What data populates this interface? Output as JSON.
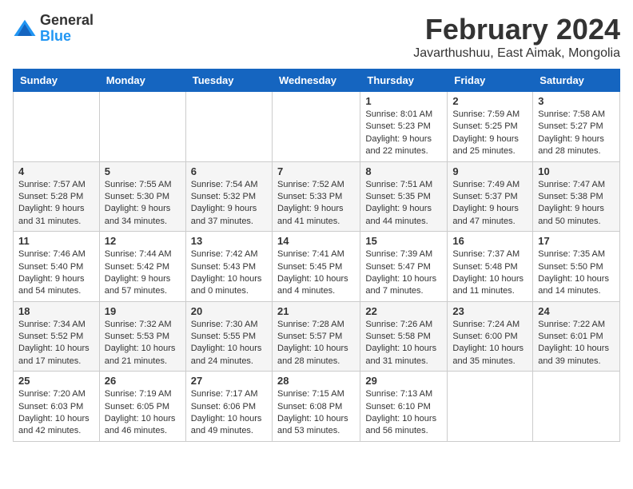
{
  "logo": {
    "general": "General",
    "blue": "Blue"
  },
  "title": "February 2024",
  "location": "Javarthushuu, East Aimak, Mongolia",
  "weekdays": [
    "Sunday",
    "Monday",
    "Tuesday",
    "Wednesday",
    "Thursday",
    "Friday",
    "Saturday"
  ],
  "weeks": [
    [
      {
        "day": "",
        "sunrise": "",
        "sunset": "",
        "daylight": ""
      },
      {
        "day": "",
        "sunrise": "",
        "sunset": "",
        "daylight": ""
      },
      {
        "day": "",
        "sunrise": "",
        "sunset": "",
        "daylight": ""
      },
      {
        "day": "",
        "sunrise": "",
        "sunset": "",
        "daylight": ""
      },
      {
        "day": "1",
        "sunrise": "Sunrise: 8:01 AM",
        "sunset": "Sunset: 5:23 PM",
        "daylight": "Daylight: 9 hours and 22 minutes."
      },
      {
        "day": "2",
        "sunrise": "Sunrise: 7:59 AM",
        "sunset": "Sunset: 5:25 PM",
        "daylight": "Daylight: 9 hours and 25 minutes."
      },
      {
        "day": "3",
        "sunrise": "Sunrise: 7:58 AM",
        "sunset": "Sunset: 5:27 PM",
        "daylight": "Daylight: 9 hours and 28 minutes."
      }
    ],
    [
      {
        "day": "4",
        "sunrise": "Sunrise: 7:57 AM",
        "sunset": "Sunset: 5:28 PM",
        "daylight": "Daylight: 9 hours and 31 minutes."
      },
      {
        "day": "5",
        "sunrise": "Sunrise: 7:55 AM",
        "sunset": "Sunset: 5:30 PM",
        "daylight": "Daylight: 9 hours and 34 minutes."
      },
      {
        "day": "6",
        "sunrise": "Sunrise: 7:54 AM",
        "sunset": "Sunset: 5:32 PM",
        "daylight": "Daylight: 9 hours and 37 minutes."
      },
      {
        "day": "7",
        "sunrise": "Sunrise: 7:52 AM",
        "sunset": "Sunset: 5:33 PM",
        "daylight": "Daylight: 9 hours and 41 minutes."
      },
      {
        "day": "8",
        "sunrise": "Sunrise: 7:51 AM",
        "sunset": "Sunset: 5:35 PM",
        "daylight": "Daylight: 9 hours and 44 minutes."
      },
      {
        "day": "9",
        "sunrise": "Sunrise: 7:49 AM",
        "sunset": "Sunset: 5:37 PM",
        "daylight": "Daylight: 9 hours and 47 minutes."
      },
      {
        "day": "10",
        "sunrise": "Sunrise: 7:47 AM",
        "sunset": "Sunset: 5:38 PM",
        "daylight": "Daylight: 9 hours and 50 minutes."
      }
    ],
    [
      {
        "day": "11",
        "sunrise": "Sunrise: 7:46 AM",
        "sunset": "Sunset: 5:40 PM",
        "daylight": "Daylight: 9 hours and 54 minutes."
      },
      {
        "day": "12",
        "sunrise": "Sunrise: 7:44 AM",
        "sunset": "Sunset: 5:42 PM",
        "daylight": "Daylight: 9 hours and 57 minutes."
      },
      {
        "day": "13",
        "sunrise": "Sunrise: 7:42 AM",
        "sunset": "Sunset: 5:43 PM",
        "daylight": "Daylight: 10 hours and 0 minutes."
      },
      {
        "day": "14",
        "sunrise": "Sunrise: 7:41 AM",
        "sunset": "Sunset: 5:45 PM",
        "daylight": "Daylight: 10 hours and 4 minutes."
      },
      {
        "day": "15",
        "sunrise": "Sunrise: 7:39 AM",
        "sunset": "Sunset: 5:47 PM",
        "daylight": "Daylight: 10 hours and 7 minutes."
      },
      {
        "day": "16",
        "sunrise": "Sunrise: 7:37 AM",
        "sunset": "Sunset: 5:48 PM",
        "daylight": "Daylight: 10 hours and 11 minutes."
      },
      {
        "day": "17",
        "sunrise": "Sunrise: 7:35 AM",
        "sunset": "Sunset: 5:50 PM",
        "daylight": "Daylight: 10 hours and 14 minutes."
      }
    ],
    [
      {
        "day": "18",
        "sunrise": "Sunrise: 7:34 AM",
        "sunset": "Sunset: 5:52 PM",
        "daylight": "Daylight: 10 hours and 17 minutes."
      },
      {
        "day": "19",
        "sunrise": "Sunrise: 7:32 AM",
        "sunset": "Sunset: 5:53 PM",
        "daylight": "Daylight: 10 hours and 21 minutes."
      },
      {
        "day": "20",
        "sunrise": "Sunrise: 7:30 AM",
        "sunset": "Sunset: 5:55 PM",
        "daylight": "Daylight: 10 hours and 24 minutes."
      },
      {
        "day": "21",
        "sunrise": "Sunrise: 7:28 AM",
        "sunset": "Sunset: 5:57 PM",
        "daylight": "Daylight: 10 hours and 28 minutes."
      },
      {
        "day": "22",
        "sunrise": "Sunrise: 7:26 AM",
        "sunset": "Sunset: 5:58 PM",
        "daylight": "Daylight: 10 hours and 31 minutes."
      },
      {
        "day": "23",
        "sunrise": "Sunrise: 7:24 AM",
        "sunset": "Sunset: 6:00 PM",
        "daylight": "Daylight: 10 hours and 35 minutes."
      },
      {
        "day": "24",
        "sunrise": "Sunrise: 7:22 AM",
        "sunset": "Sunset: 6:01 PM",
        "daylight": "Daylight: 10 hours and 39 minutes."
      }
    ],
    [
      {
        "day": "25",
        "sunrise": "Sunrise: 7:20 AM",
        "sunset": "Sunset: 6:03 PM",
        "daylight": "Daylight: 10 hours and 42 minutes."
      },
      {
        "day": "26",
        "sunrise": "Sunrise: 7:19 AM",
        "sunset": "Sunset: 6:05 PM",
        "daylight": "Daylight: 10 hours and 46 minutes."
      },
      {
        "day": "27",
        "sunrise": "Sunrise: 7:17 AM",
        "sunset": "Sunset: 6:06 PM",
        "daylight": "Daylight: 10 hours and 49 minutes."
      },
      {
        "day": "28",
        "sunrise": "Sunrise: 7:15 AM",
        "sunset": "Sunset: 6:08 PM",
        "daylight": "Daylight: 10 hours and 53 minutes."
      },
      {
        "day": "29",
        "sunrise": "Sunrise: 7:13 AM",
        "sunset": "Sunset: 6:10 PM",
        "daylight": "Daylight: 10 hours and 56 minutes."
      },
      {
        "day": "",
        "sunrise": "",
        "sunset": "",
        "daylight": ""
      },
      {
        "day": "",
        "sunrise": "",
        "sunset": "",
        "daylight": ""
      }
    ]
  ]
}
